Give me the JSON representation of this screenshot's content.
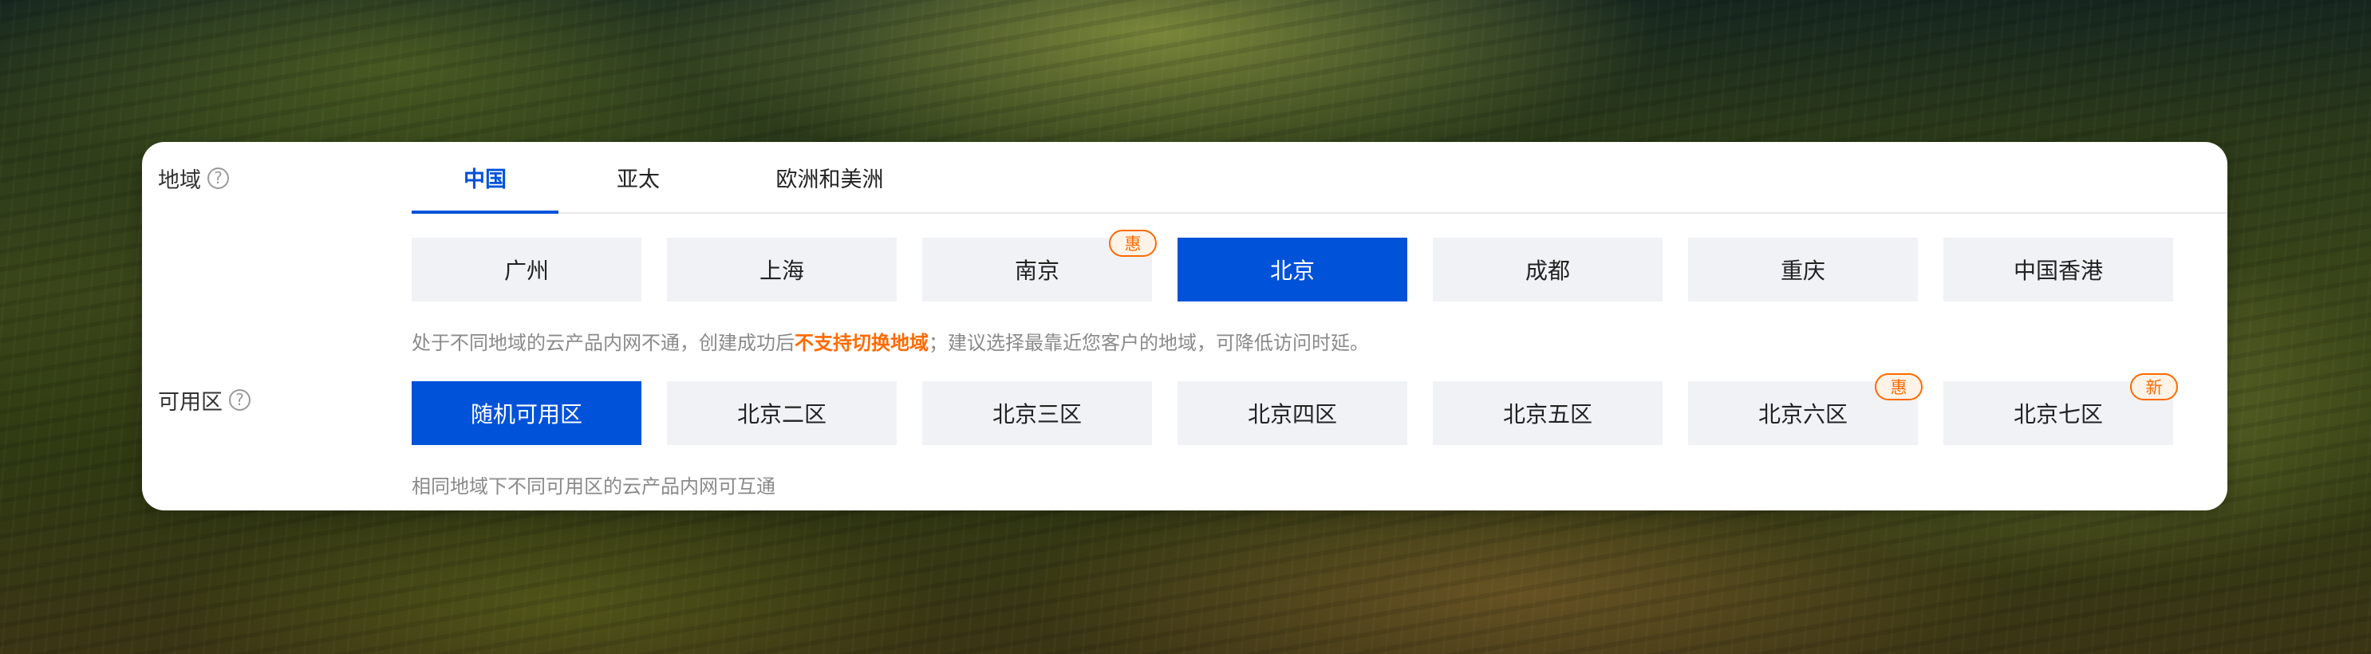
{
  "region": {
    "label": "地域",
    "tabs": [
      {
        "label": "中国",
        "active": true
      },
      {
        "label": "亚太",
        "active": false
      },
      {
        "label": "欧洲和美洲",
        "active": false
      }
    ],
    "options": [
      {
        "label": "广州",
        "selected": false,
        "badge": ""
      },
      {
        "label": "上海",
        "selected": false,
        "badge": ""
      },
      {
        "label": "南京",
        "selected": false,
        "badge": "惠"
      },
      {
        "label": "北京",
        "selected": true,
        "badge": ""
      },
      {
        "label": "成都",
        "selected": false,
        "badge": ""
      },
      {
        "label": "重庆",
        "selected": false,
        "badge": ""
      },
      {
        "label": "中国香港",
        "selected": false,
        "badge": ""
      }
    ],
    "hint_before": "处于不同地域的云产品内网不通，创建成功后",
    "hint_emphasis": "不支持切换地域",
    "hint_after": "；建议选择最靠近您客户的地域，可降低访问时延。"
  },
  "zone": {
    "label": "可用区",
    "options": [
      {
        "label": "随机可用区",
        "selected": true,
        "badge": ""
      },
      {
        "label": "北京二区",
        "selected": false,
        "badge": ""
      },
      {
        "label": "北京三区",
        "selected": false,
        "badge": ""
      },
      {
        "label": "北京四区",
        "selected": false,
        "badge": ""
      },
      {
        "label": "北京五区",
        "selected": false,
        "badge": ""
      },
      {
        "label": "北京六区",
        "selected": false,
        "badge": "惠"
      },
      {
        "label": "北京七区",
        "selected": false,
        "badge": "新"
      }
    ],
    "hint": "相同地域下不同可用区的云产品内网可互通"
  },
  "icons": {
    "help": "help-circle-icon"
  },
  "colors": {
    "accent": "#0052d9",
    "promo": "#ff6a00",
    "option_bg": "#f0f2f5"
  }
}
